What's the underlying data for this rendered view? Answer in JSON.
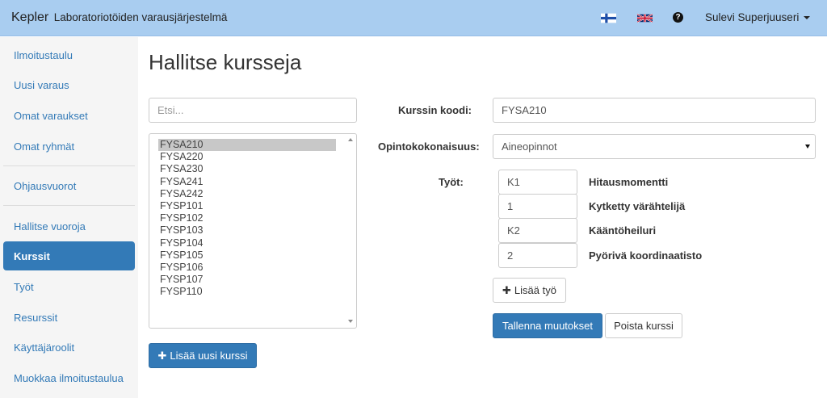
{
  "header": {
    "brand": "Kepler",
    "subtitle": "Laboratoriotöiden varausjärjestelmä",
    "flags": [
      "finnish-flag-icon",
      "uk-flag-icon"
    ],
    "help_icon": "?",
    "user_name": "Sulevi Superjuuseri"
  },
  "sidebar": {
    "items": [
      {
        "label": "Ilmoitustaulu"
      },
      {
        "label": "Uusi varaus"
      },
      {
        "label": "Omat varaukset"
      },
      {
        "label": "Omat ryhmät"
      },
      {
        "label": "Ohjausvuorot"
      },
      {
        "label": "Hallitse vuoroja"
      },
      {
        "label": "Kurssit"
      },
      {
        "label": "Työt"
      },
      {
        "label": "Resurssit"
      },
      {
        "label": "Käyttäjäroolit"
      },
      {
        "label": "Muokkaa ilmoitustaulua"
      }
    ],
    "active": "Kurssit"
  },
  "main": {
    "title": "Hallitse kursseja",
    "search_placeholder": "Etsi...",
    "courses": [
      "FYSA210",
      "FYSA220",
      "FYSA230",
      "FYSA241",
      "FYSA242",
      "FYSP101",
      "FYSP102",
      "FYSP103",
      "FYSP104",
      "FYSP105",
      "FYSP106",
      "FYSP107",
      "FYSP110"
    ],
    "selected_course": "FYSA210",
    "add_course_label": "Lisää uusi kurssi"
  },
  "form": {
    "code_label": "Kurssin koodi:",
    "code_value": "FYSA210",
    "module_label": "Opintokokonaisuus:",
    "module_value": "Aineopinnot",
    "works_label": "Työt:",
    "works": [
      {
        "code": "K1",
        "name": "Hitausmomentti"
      },
      {
        "code": "1",
        "name": "Kytketty värähtelijä"
      },
      {
        "code": "K2",
        "name": "Kääntöheiluri"
      },
      {
        "code": "2",
        "name": "Pyörivä koordinaatisto"
      }
    ],
    "add_work_label": "Lisää työ",
    "save_label": "Tallenna muutokset",
    "delete_label": "Poista kurssi"
  },
  "colors": {
    "topbar": "#a9cdf0",
    "primary": "#337ab7",
    "sidebar_bg": "#f5f5f5"
  }
}
